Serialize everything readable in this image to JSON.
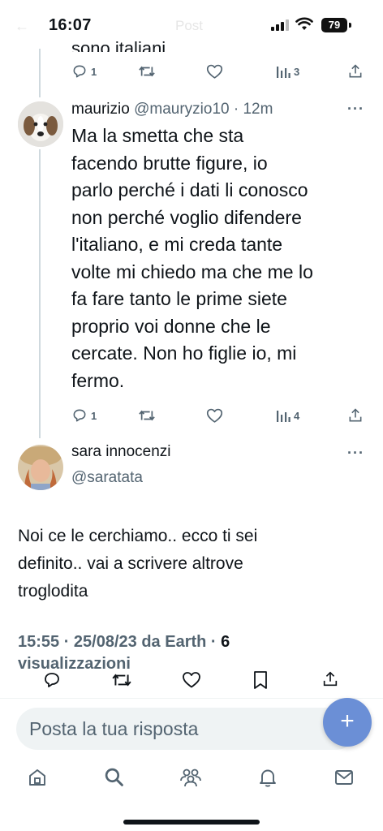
{
  "status_bar": {
    "time": "16:07",
    "battery": "79",
    "faded_back": "←",
    "faded_title": "Post"
  },
  "previous_tweet": {
    "cut_text": "sono italiani",
    "actions": {
      "reply_count": "1",
      "views_count": "3"
    }
  },
  "tweet_maurizio": {
    "name": "maurizio",
    "handle_time": "@mauryzio10 · 12m",
    "more": "···",
    "lines": [
      "Ma la smetta che sta",
      "facendo brutte figure, io",
      "parlo perché i dati li conosco",
      "non perché voglio difendere",
      "l'italiano, e mi creda tante",
      "volte mi chiedo ma che me lo",
      "fa fare tanto le prime siete",
      "proprio voi donne che le",
      "cercate. Non ho figlie io, mi",
      "fermo."
    ],
    "actions": {
      "reply_count": "1",
      "views_count": "4"
    }
  },
  "main_tweet": {
    "name": "sara innocenzi",
    "handle": "@saratata",
    "more": "···",
    "lines": [
      "Noi ce le cerchiamo.. ecco ti sei",
      "definito.. vai a scrivere altrove",
      "troglodita"
    ],
    "meta_line1": "15:55 · 25/08/23 da Earth · ",
    "meta_views_num": "6",
    "meta_line2": "visualizzazioni"
  },
  "reply_bar": {
    "placeholder": "Posta la tua risposta",
    "fab_label": "+"
  },
  "colors": {
    "muted": "#536471",
    "text": "#0f1419",
    "fab": "#6b8fd6",
    "thread_line": "#cfd9de"
  },
  "icons": [
    "reply-icon",
    "retweet-icon",
    "like-icon",
    "views-icon",
    "share-icon",
    "bookmark-icon",
    "home-icon",
    "search-icon",
    "communities-icon",
    "notifications-icon",
    "messages-icon",
    "more-icon",
    "plus-icon"
  ]
}
